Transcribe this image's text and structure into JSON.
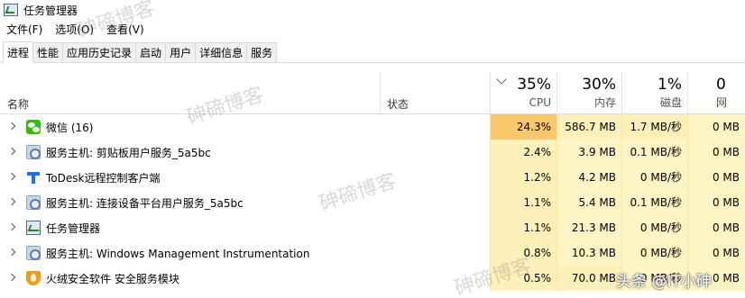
{
  "window": {
    "title": "任务管理器"
  },
  "menu": [
    "文件(F)",
    "选项(O)",
    "查看(V)"
  ],
  "tabs": [
    "进程",
    "性能",
    "应用历史记录",
    "启动",
    "用户",
    "详细信息",
    "服务"
  ],
  "active_tab": 0,
  "columns": {
    "name": "名称",
    "status": "状态",
    "cpu": {
      "pct": "35%",
      "label": "CPU"
    },
    "memory": {
      "pct": "30%",
      "label": "内存"
    },
    "disk": {
      "pct": "1%",
      "label": "磁盘"
    },
    "network": {
      "pct": "0",
      "label": "网"
    }
  },
  "processes": [
    {
      "name": "微信 (16)",
      "icon": "wechat-icon",
      "cpu": "24.3%",
      "memory": "586.7 MB",
      "disk": "1.7 MB/秒",
      "network": "0 MB"
    },
    {
      "name": "服务主机: 剪贴板用户服务_5a5bc",
      "icon": "gear-icon",
      "cpu": "2.4%",
      "memory": "3.9 MB",
      "disk": "0.1 MB/秒",
      "network": "0 MB"
    },
    {
      "name": "ToDesk远程控制客户端",
      "icon": "todesk-icon",
      "cpu": "1.2%",
      "memory": "4.2 MB",
      "disk": "0 MB/秒",
      "network": "0 MB"
    },
    {
      "name": "服务主机: 连接设备平台用户服务_5a5bc",
      "icon": "gear-icon",
      "cpu": "1.1%",
      "memory": "5.4 MB",
      "disk": "0.1 MB/秒",
      "network": "0 MB"
    },
    {
      "name": "任务管理器",
      "icon": "task-manager-icon",
      "cpu": "1.1%",
      "memory": "21.3 MB",
      "disk": "0 MB/秒",
      "network": "0 MB"
    },
    {
      "name": "服务主机: Windows Management Instrumentation",
      "icon": "gear-icon",
      "cpu": "0.8%",
      "memory": "10.3 MB",
      "disk": "0 MB/秒",
      "network": "0 MB"
    },
    {
      "name": "火绒安全软件 安全服务模块",
      "icon": "shield-icon",
      "cpu": "0.5%",
      "memory": "70.0 MB",
      "disk": "0 MB/秒",
      "network": "0 MB"
    }
  ],
  "watermarks": [
    "砷碲博客",
    "砷碲博客",
    "砷碲博客",
    "砷碲博客"
  ],
  "footer_watermark": "头条 @IT小砷",
  "colors": {
    "cpu_high": "#f9c86a",
    "cell_light": "#fff4c4",
    "cell_mid": "#fdf0b8"
  }
}
